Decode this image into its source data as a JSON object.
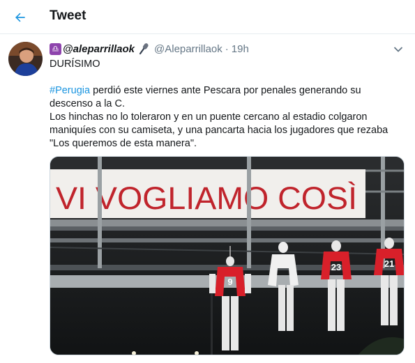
{
  "header": {
    "title": "Tweet"
  },
  "tweet": {
    "badge": "♎",
    "display_name": "@aleparrillaok",
    "handle": "@Aleparrillaok",
    "separator": "·",
    "time": "19h",
    "line1": "DURÍSIMO",
    "hashtag": "#Perugia",
    "p1_rest": " perdió este viernes ante Pescara por penales generando su descenso a la C.",
    "p2": "Los hinchas no lo toleraron y en un puente cercano al estadio colgaron maniquíes con su camiseta, y una pancarta hacia los jugadores que rezaba \"Los queremos de esta manera\"."
  },
  "media": {
    "banner_text": "VI VOGLIAMO COSÌ",
    "jersey_numbers": [
      "9",
      "",
      "23",
      "21"
    ]
  },
  "colors": {
    "accent": "#1b95e0",
    "jersey": "#d8202a",
    "banner_text": "#c0242c"
  },
  "icons": [
    "back-arrow-icon",
    "zodiac-badge-icon",
    "microphone-icon",
    "chevron-down-icon"
  ]
}
